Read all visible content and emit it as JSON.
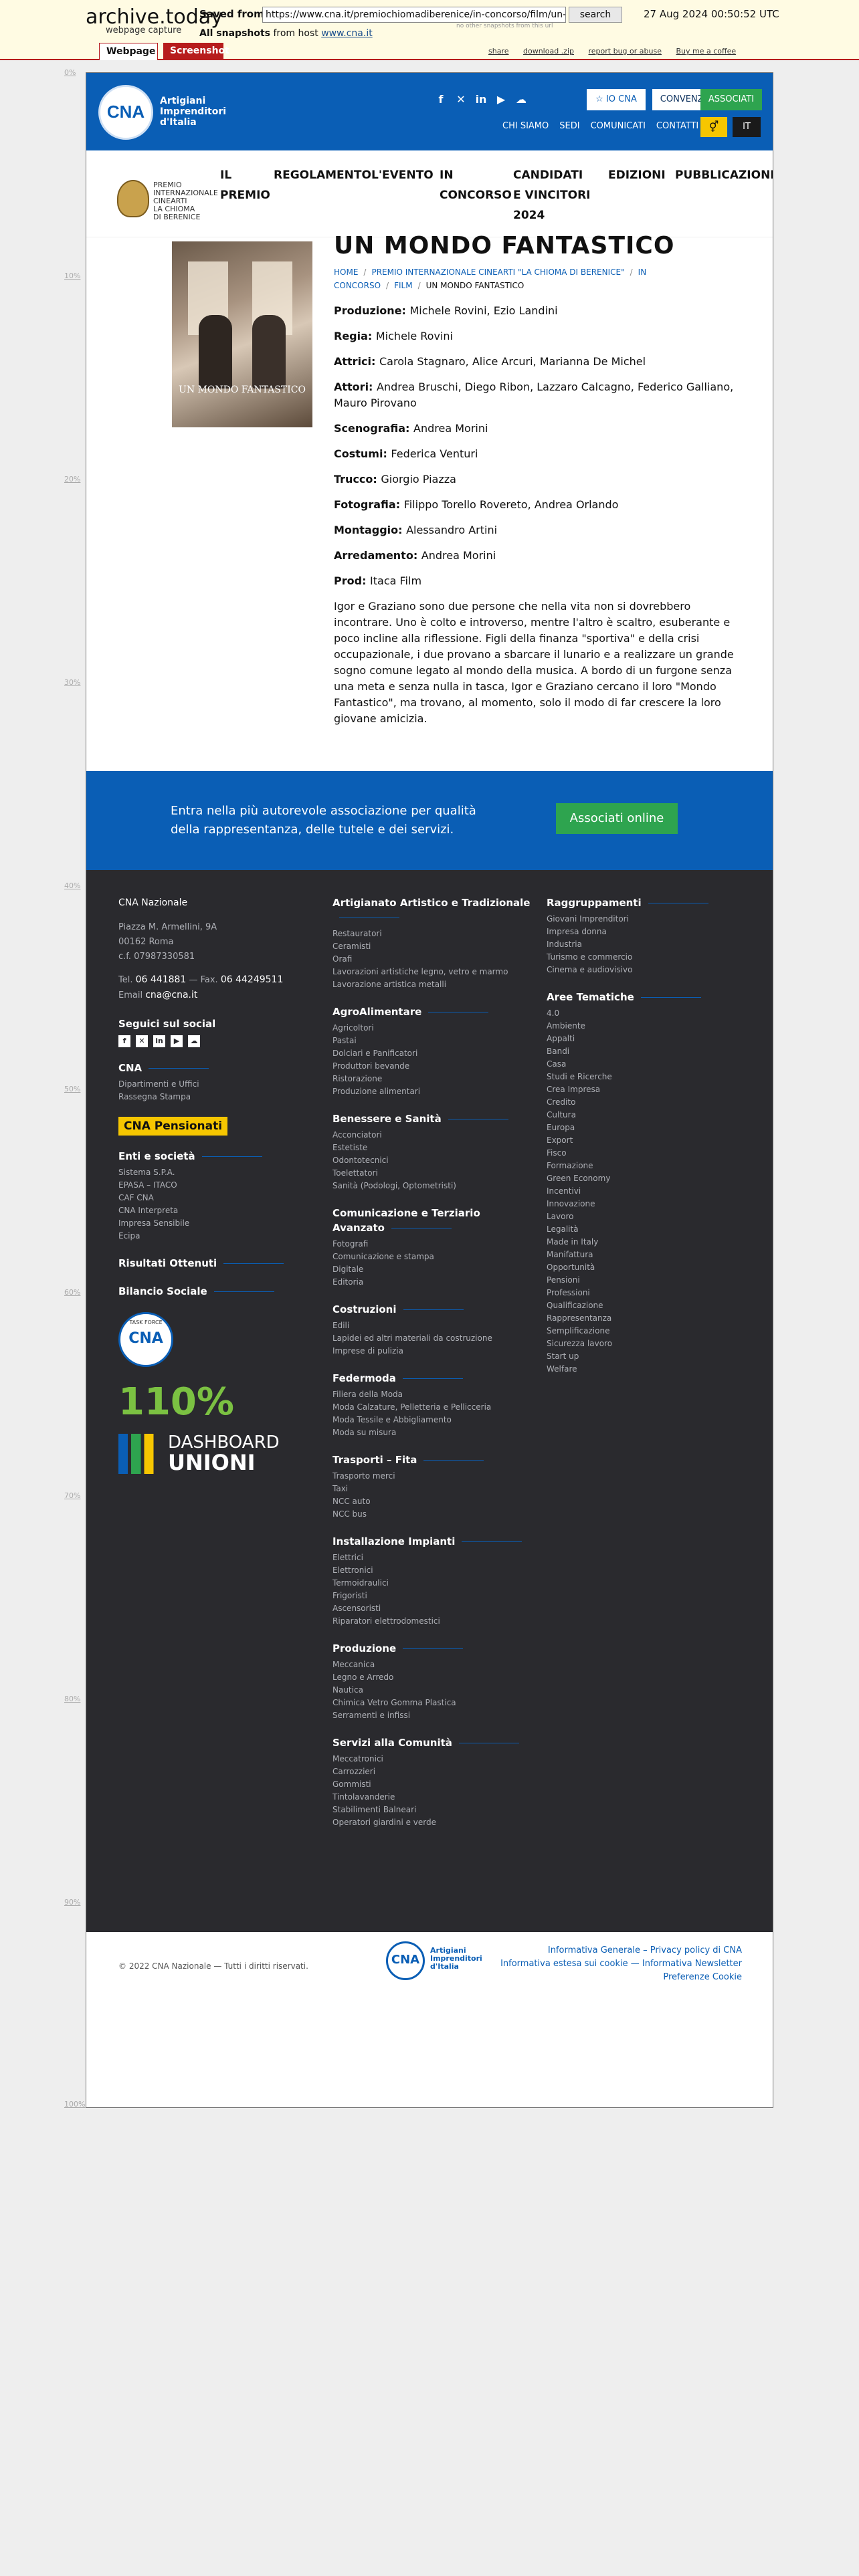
{
  "archive": {
    "logo": "archive.today",
    "subtitle": "webpage capture",
    "saved_from_label": "Saved from",
    "url": "https://www.cna.it/premiochiomadiberenice/in-concorso/film/un-mondo-fantastico/",
    "search_label": "search",
    "date": "27 Aug 2024 00:50:52 UTC",
    "no_other": "no other snapshots from this url",
    "all_snapshots_label": "All snapshots",
    "from_host_label": "from host",
    "host": "www.cna.it",
    "tab_webpage": "Webpage",
    "tab_screenshot": "Screenshot",
    "links": [
      "share",
      "download .zip",
      "report bug or abuse",
      "Buy me a coffee"
    ],
    "ruler": [
      "0%",
      "10%",
      "20%",
      "30%",
      "40%",
      "50%",
      "60%",
      "70%",
      "80%",
      "90%",
      "100%"
    ]
  },
  "header": {
    "logo": "CNA",
    "brand": [
      "Artigiani",
      "Imprenditori",
      "d'Italia"
    ],
    "social_icons": [
      "facebook-icon",
      "x-icon",
      "linkedin-icon",
      "youtube-icon",
      "cloud-icon"
    ],
    "io_cna": "IO CNA",
    "convenzioni": "CONVENZIONI",
    "associati": "ASSOCIATI",
    "links": [
      "CHI SIAMO",
      "SEDI",
      "COMUNICATI",
      "CONTATTI"
    ],
    "lang": "IT"
  },
  "subnav": {
    "logo_text": [
      "PREMIO",
      "INTERNAZIONALE",
      "CINEARTI",
      "LA CHIOMA",
      "DI BERENICE"
    ],
    "items": [
      "IL PREMIO",
      "REGOLAMENTO",
      "L'EVENTO",
      "IN CONCORSO",
      "CANDIDATI E VINCITORI 2024",
      "EDIZIONI",
      "PUBBLICAZIONI"
    ]
  },
  "film": {
    "title": "UN MONDO FANTASTICO",
    "poster_caption": "UN MONDO FANTASTICO",
    "breadcrumb": [
      "HOME",
      "PREMIO INTERNAZIONALE CINEARTI \"LA CHIOMA DI BERENICE\"",
      "IN CONCORSO",
      "FILM",
      "UN MONDO FANTASTICO"
    ],
    "credits": [
      {
        "label": "Produzione",
        "value": "Michele Rovini, Ezio Landini"
      },
      {
        "label": "Regia",
        "value": "Michele Rovini"
      },
      {
        "label": "Attrici",
        "value": "Carola Stagnaro, Alice Arcuri, Marianna De Michel"
      },
      {
        "label": "Attori",
        "value": "Andrea Bruschi, Diego Ribon, Lazzaro Calcagno, Federico Galliano, Mauro Pirovano"
      },
      {
        "label": "Scenografia",
        "value": "Andrea Morini"
      },
      {
        "label": "Costumi",
        "value": "Federica Venturi"
      },
      {
        "label": "Trucco",
        "value": "Giorgio Piazza"
      },
      {
        "label": "Fotografia",
        "value": "Filippo Torello Rovereto, Andrea Orlando"
      },
      {
        "label": "Montaggio",
        "value": "Alessandro Artini"
      },
      {
        "label": "Arredamento",
        "value": "Andrea Morini"
      },
      {
        "label": "Prod",
        "value": "Itaca Film"
      }
    ],
    "synopsis": "Igor e Graziano sono due persone che nella vita non si dovrebbero incontrare. Uno è colto e introverso, mentre l'altro è scaltro, esuberante e poco incline alla riflessione. Figli della finanza \"sportiva\" e della crisi occupazionale, i due provano a sbarcare il lunario e a realizzare un grande sogno comune legato al mondo della musica. A bordo di un furgone senza una meta e senza nulla in tasca, Igor e Graziano cercano il loro \"Mondo Fantastico\", ma trovano, al momento, solo il modo di far crescere la loro giovane amicizia."
  },
  "cta": {
    "text": "Entra nella più autorevole associazione per qualità della rappresentanza, delle tutele e dei servizi.",
    "button": "Associati online"
  },
  "footer": {
    "col1": {
      "org": "CNA Nazionale",
      "address": [
        "Piazza M. Armellini, 9A",
        "00162 Roma",
        "c.f. 07987330581"
      ],
      "tel_label": "Tel.",
      "tel": "06 441881",
      "fax_label": "Fax.",
      "fax": "06 44249511",
      "email_label": "Email",
      "email": "cna@cna.it",
      "social_heading": "Seguici sul social",
      "cna_heading": "CNA",
      "cna_items": [
        "Dipartimenti e Uffici",
        "Rassegna Stampa"
      ],
      "pensionati": "CNA Pensionati",
      "enti_heading": "Enti e società",
      "enti_items": [
        "Sistema S.P.A.",
        "EPASA – ITACO",
        "CAF CNA",
        "CNA Interpreta",
        "Impresa Sensibile",
        "Ecipa"
      ],
      "risultati": "Risultati Ottenuti",
      "bilancio": "Bilancio Sociale",
      "badge_small": "TASK FORCE",
      "p110": "110%",
      "dashboard": "DASHBOARD",
      "unioni": "UNIONI"
    },
    "col2": [
      {
        "heading": "Artigianato Artistico e Tradizionale",
        "items": [
          "Restauratori",
          "Ceramisti",
          "Orafi",
          "Lavorazioni artistiche legno, vetro e marmo",
          "Lavorazione artistica metalli"
        ]
      },
      {
        "heading": "AgroAlimentare",
        "items": [
          "Agricoltori",
          "Pastai",
          "Dolciari e Panificatori",
          "Produttori bevande",
          "Ristorazione",
          "Produzione alimentari"
        ]
      },
      {
        "heading": "Benessere e Sanità",
        "items": [
          "Acconciatori",
          "Estetiste",
          "Odontotecnici",
          "Toelettatori",
          "Sanità (Podologi, Optometristi)"
        ]
      },
      {
        "heading": "Comunicazione e Terziario Avanzato",
        "items": [
          "Fotografi",
          "Comunicazione e stampa",
          "Digitale",
          "Editoria"
        ]
      },
      {
        "heading": "Costruzioni",
        "items": [
          "Edili",
          "Lapidei ed altri materiali da costruzione",
          "Imprese di pulizia"
        ]
      },
      {
        "heading": "Federmoda",
        "items": [
          "Filiera della Moda",
          "Moda Calzature, Pelletteria e Pellicceria",
          "Moda Tessile e Abbigliamento",
          "Moda su misura"
        ]
      },
      {
        "heading": "Trasporti – Fita",
        "items": [
          "Trasporto merci",
          "Taxi",
          "NCC auto",
          "NCC bus"
        ]
      },
      {
        "heading": "Installazione Impianti",
        "items": [
          "Elettrici",
          "Elettronici",
          "Termoidraulici",
          "Frigoristi",
          "Ascensoristi",
          "Riparatori elettrodomestici"
        ]
      },
      {
        "heading": "Produzione",
        "items": [
          "Meccanica",
          "Legno e Arredo",
          "Nautica",
          "Chimica Vetro Gomma Plastica",
          "Serramenti e infissi"
        ]
      },
      {
        "heading": "Servizi alla Comunità",
        "items": [
          "Meccatronici",
          "Carrozzieri",
          "Gommisti",
          "Tintolavanderie",
          "Stabilimenti Balneari",
          "Operatori giardini e verde"
        ]
      }
    ],
    "col3": [
      {
        "heading": "Raggruppamenti",
        "items": [
          "Giovani Imprenditori",
          "Impresa donna",
          "Industria",
          "Turismo e commercio",
          "Cinema e audiovisivo"
        ]
      },
      {
        "heading": "Aree Tematiche",
        "items": [
          "4.0",
          "Ambiente",
          "Appalti",
          "Bandi",
          "Casa",
          "Studi e Ricerche",
          "Crea Impresa",
          "Credito",
          "Cultura",
          "Europa",
          "Export",
          "Fisco",
          "Formazione",
          "Green Economy",
          "Incentivi",
          "Innovazione",
          "Lavoro",
          "Legalità",
          "Made in Italy",
          "Manifattura",
          "Opportunità",
          "Pensioni",
          "Professioni",
          "Qualificazione",
          "Rappresentanza",
          "Semplificazione",
          "Sicurezza lavoro",
          "Start up",
          "Welfare"
        ]
      }
    ]
  },
  "bottom": {
    "copyright": "© 2022 CNA Nazionale — Tutti i diritti riservati.",
    "logo": "CNA",
    "brand": [
      "Artigiani",
      "Imprenditori",
      "d'Italia"
    ],
    "links": [
      "Informativa Generale – Privacy policy di CNA",
      "Informativa estesa sui cookie — Informativa Newsletter",
      "Preferenze Cookie"
    ]
  },
  "colors": {
    "brand_blue": "#0a5eb5",
    "green": "#2ea44f",
    "yellow": "#f6c600",
    "footer_dark": "#2a2a2e",
    "archive_red": "#b71c1c"
  }
}
